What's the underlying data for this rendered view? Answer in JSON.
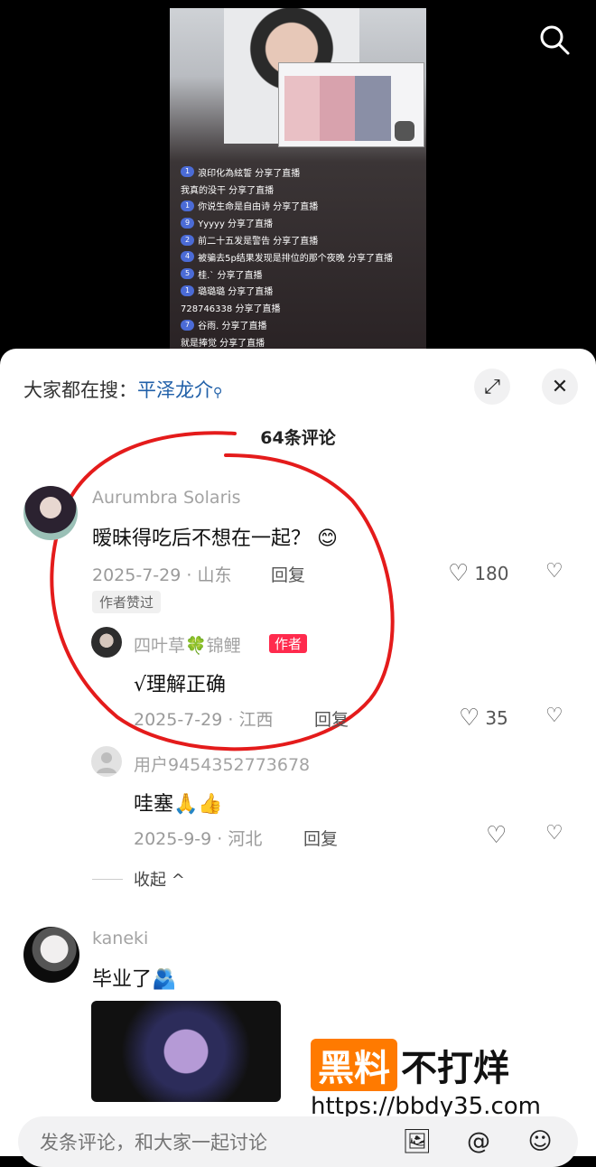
{
  "top": {
    "chat": [
      {
        "badge": "1",
        "text": "浪印化為絃誓 分享了直播"
      },
      {
        "badge": "",
        "text": "我真的没干 分享了直播"
      },
      {
        "badge": "1",
        "text": "你说生命是自由诗 分享了直播"
      },
      {
        "badge": "9",
        "text": "Yyyyy 分享了直播"
      },
      {
        "badge": "2",
        "text": "前二十五发是警告 分享了直播"
      },
      {
        "badge": "4",
        "text": "被骗去5p结果发现是排位的那个夜晚 分享了直播"
      },
      {
        "badge": "5",
        "text": "桂.` 分享了直播"
      },
      {
        "badge": "1",
        "text": "璐璐璐 分享了直播"
      },
      {
        "badge": "",
        "text": "728746338 分享了直播"
      },
      {
        "badge": "7",
        "text": "谷雨. 分享了直播"
      },
      {
        "badge": "",
        "text": "就是捧觉 分享了直播"
      }
    ]
  },
  "panel": {
    "trend_label": "大家都在搜：",
    "trend_keyword": "平泽龙介",
    "comment_count": "64条评论",
    "comments": [
      {
        "user": "Aurumbra Solaris",
        "text": "暧昧得吃后不想在一起？ 😊",
        "date": "2025-7-29 · 山东",
        "reply": "回复",
        "likes": "180",
        "tag": "作者赞过"
      },
      {
        "user": "四叶草🍀锦鲤",
        "author_tag": "作者",
        "text": "√理解正确",
        "date": "2025-7-29 · 江西",
        "reply": "回复",
        "likes": "35"
      },
      {
        "user": "用户9454352773678",
        "text": "哇塞🙏👍",
        "date": "2025-9-9 · 河北",
        "reply": "回复",
        "likes": ""
      },
      {
        "user": "kaneki",
        "text": "毕业了🫂"
      }
    ],
    "collapse": "收起 ^",
    "watermark_orange": "黑料",
    "watermark_dark": "不打烊",
    "watermark_url": "https://bbdy35.com",
    "input_placeholder": "发条评论，和大家一起讨论"
  }
}
